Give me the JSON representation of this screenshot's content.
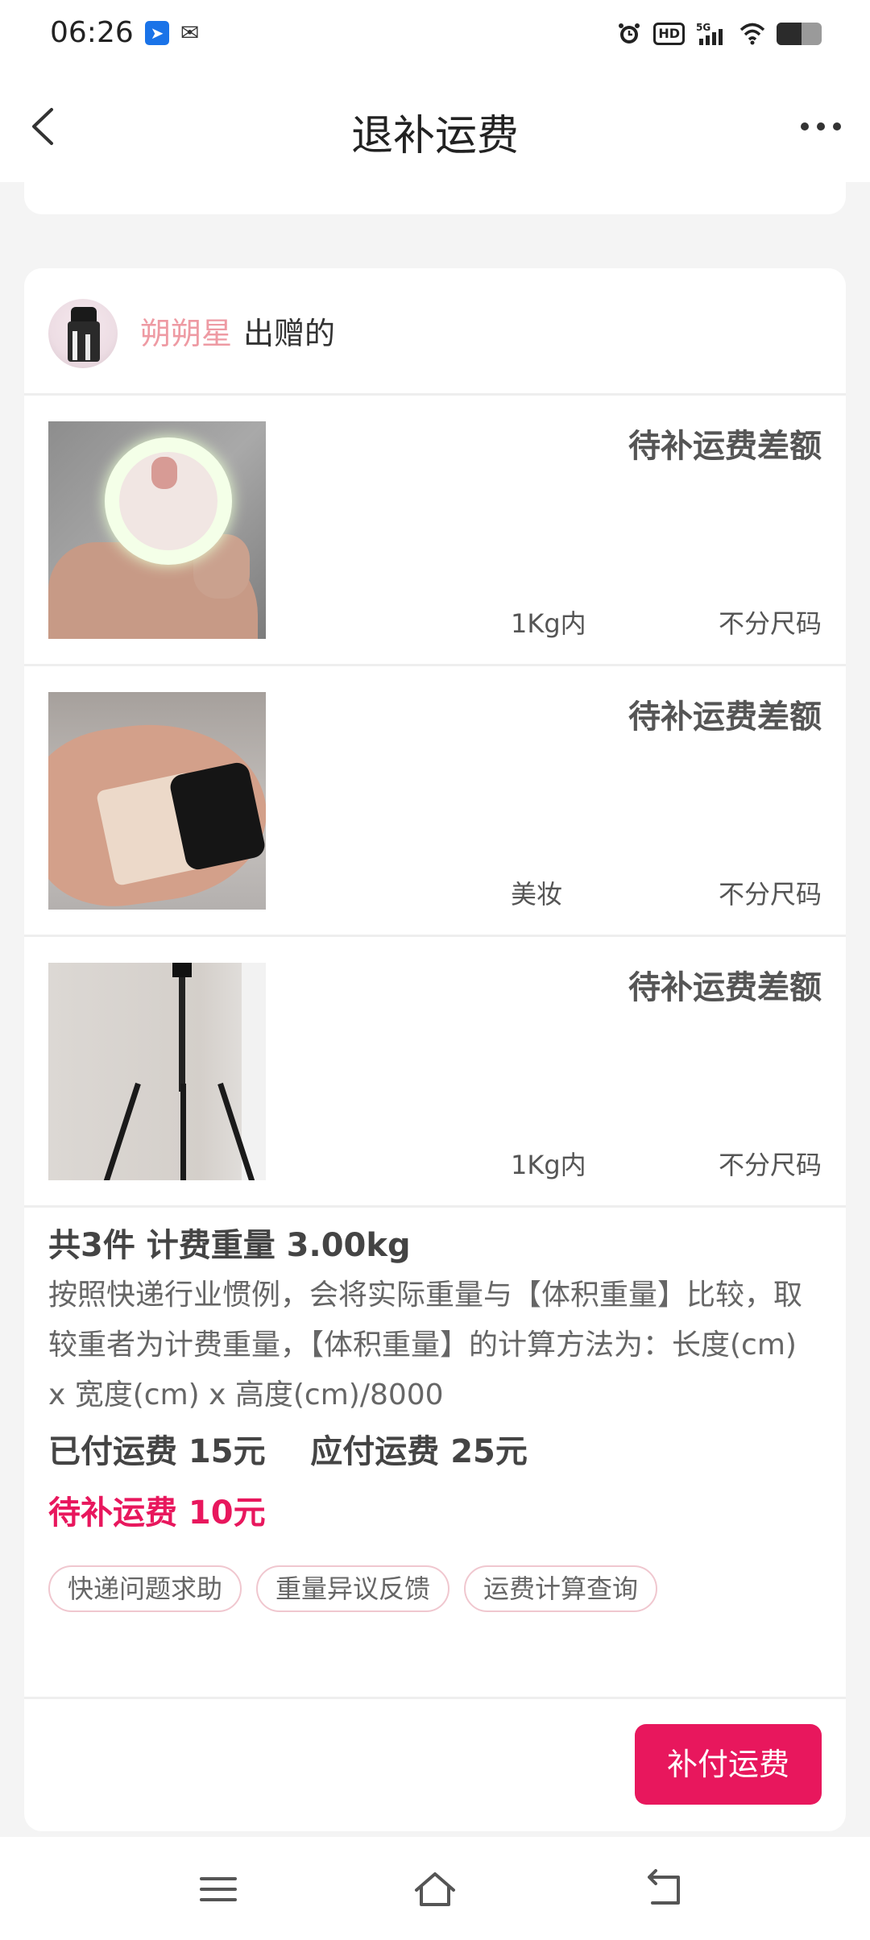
{
  "status_bar": {
    "time": "06:26",
    "hd_label": "HD",
    "network": "5G",
    "battery_level": 0.55,
    "icons": [
      "app-notification-icon",
      "wechat-icon",
      "alarm-icon",
      "hd-icon",
      "signal-icon",
      "wifi-icon",
      "battery-icon"
    ]
  },
  "nav": {
    "title": "退补运费",
    "back_icon": "chevron-left-icon",
    "more_icon": "more-horizontal-icon"
  },
  "giver": {
    "name": "朔朔星",
    "suffix": "出赠的"
  },
  "items": [
    {
      "status": "待补运费差额",
      "category": "1Kg内",
      "size": "不分尺码",
      "image": "ring-light-photo"
    },
    {
      "status": "待补运费差额",
      "category": "美妆",
      "size": "不分尺码",
      "image": "foundation-bottle-photo"
    },
    {
      "status": "待补运费差额",
      "category": "1Kg内",
      "size": "不分尺码",
      "image": "tripod-photo"
    }
  ],
  "summary": {
    "title": "共3件 计费重量 3.00kg",
    "description": "按照快递行业惯例，会将实际重量与【体积重量】比较，取较重者为计费重量，【体积重量】的计算方法为：长度(cm) x 宽度(cm) x 高度(cm)/8000",
    "paid_line": "已付运费 15元    应付运费 25元",
    "due_line": "待补运费 10元"
  },
  "chips": [
    "快递问题求助",
    "重量异议反馈",
    "运费计算查询"
  ],
  "pay_button": "补付运费",
  "colors": {
    "accent": "#e8175d",
    "giver_name": "#ee9aa3",
    "chip_border": "#f0c7cf",
    "background": "#f4f4f4"
  },
  "system_nav": {
    "icons": [
      "menu-icon",
      "home-icon",
      "back-icon"
    ]
  }
}
